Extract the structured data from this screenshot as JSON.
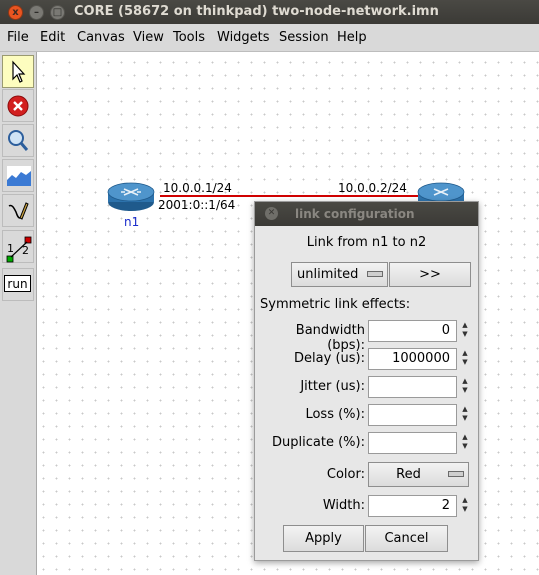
{
  "window": {
    "title": "CORE (58672 on thinkpad) two-node-network.imn",
    "close_glyph": "x",
    "min_glyph": "–",
    "max_glyph": "□"
  },
  "menu": [
    {
      "label": "File"
    },
    {
      "label": "Edit"
    },
    {
      "label": "Canvas"
    },
    {
      "label": "View"
    },
    {
      "label": "Tools"
    },
    {
      "label": "Widgets"
    },
    {
      "label": "Session"
    },
    {
      "label": "Help"
    }
  ],
  "toolbar": {
    "tools": [
      {
        "name": "select-tool",
        "icon": "arrow-cursor-icon"
      },
      {
        "name": "stop-tool",
        "icon": "stop-icon"
      },
      {
        "name": "observer-tool",
        "icon": "magnifier-icon"
      },
      {
        "name": "plot-tool",
        "icon": "graph-icon"
      },
      {
        "name": "marker-tool",
        "icon": "pen-icon"
      },
      {
        "name": "two-node-tool",
        "icon": "two-node-icon",
        "label1": "1",
        "label2": "2"
      },
      {
        "name": "run-tool",
        "icon": "run-icon",
        "label": "run"
      }
    ]
  },
  "canvas": {
    "link_color": "#d00000",
    "node1": {
      "name": "n1",
      "ipv4": "10.0.0.1/24",
      "ipv6": "2001:0::1/64"
    },
    "node2": {
      "ipv4": "10.0.0.2/24"
    },
    "node_label_color": "#1c2ecc"
  },
  "dialog": {
    "title": "link configuration",
    "header": "Link from n1 to n2",
    "preset": "unlimited",
    "advance_button": ">>",
    "section_label": "Symmetric link effects:",
    "fields": {
      "bandwidth": {
        "label": "Bandwidth (bps):",
        "value": "0"
      },
      "delay": {
        "label": "Delay (us):",
        "value": "1000000"
      },
      "jitter": {
        "label": "Jitter (us):",
        "value": ""
      },
      "loss": {
        "label": "Loss (%):",
        "value": ""
      },
      "duplicate": {
        "label": "Duplicate (%):",
        "value": ""
      },
      "color": {
        "label": "Color:",
        "value": "Red"
      },
      "width": {
        "label": "Width:",
        "value": "2"
      }
    },
    "apply_label": "Apply",
    "cancel_label": "Cancel"
  }
}
